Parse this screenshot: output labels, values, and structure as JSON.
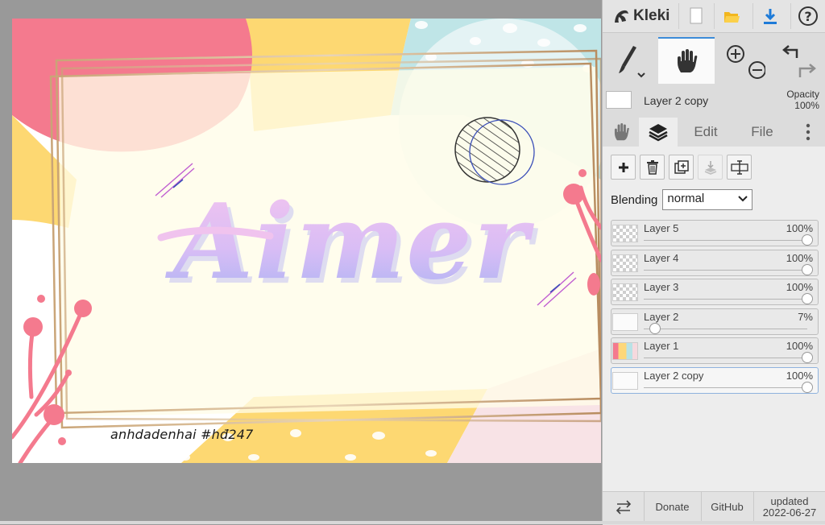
{
  "app": {
    "name": "Kleki"
  },
  "toolbar": {
    "icons": [
      "kleki-logo-icon",
      "new-file-icon",
      "open-folder-icon",
      "download-icon",
      "help-icon"
    ],
    "tools": [
      "brush-icon",
      "hand-icon",
      "zoom-in-icon",
      "zoom-out-icon",
      "undo-icon",
      "redo-icon"
    ],
    "active_tool": "hand"
  },
  "current_layer": {
    "name": "Layer 2 copy",
    "opacity_label": "Opacity",
    "opacity_value": "100%"
  },
  "tabs": [
    {
      "label": "",
      "icon": "hand-icon"
    },
    {
      "label": "",
      "icon": "layers-icon",
      "active": true
    },
    {
      "label": "Edit"
    },
    {
      "label": "File"
    },
    {
      "label": "",
      "icon": "more-vertical-icon"
    }
  ],
  "layer_actions": [
    "add-layer-icon",
    "delete-layer-icon",
    "duplicate-layer-icon",
    "merge-down-icon",
    "rename-layer-icon"
  ],
  "blending": {
    "label": "Blending",
    "value": "normal"
  },
  "layers": [
    {
      "name": "Layer 5",
      "opacity": "100%",
      "level": 1.0,
      "thumb": "checker"
    },
    {
      "name": "Layer 4",
      "opacity": "100%",
      "level": 1.0,
      "thumb": "checker"
    },
    {
      "name": "Layer 3",
      "opacity": "100%",
      "level": 1.0,
      "thumb": "checker"
    },
    {
      "name": "Layer 2",
      "opacity": "7%",
      "level": 0.07,
      "thumb": "white"
    },
    {
      "name": "Layer 1",
      "opacity": "100%",
      "level": 1.0,
      "thumb": "color"
    },
    {
      "name": "Layer 2 copy",
      "opacity": "100%",
      "level": 1.0,
      "thumb": "white",
      "active": true
    }
  ],
  "footer": {
    "donate": "Donate",
    "github": "GitHub",
    "updated_label": "updated",
    "updated_date": "2022-06-27"
  },
  "artwork": {
    "title_text": "Aimer",
    "signature": "anhdadenhai #hđ247"
  },
  "colors": {
    "pink": "#f47a8e",
    "yellow": "#fdd872",
    "mint": "#bfe5e7",
    "accent_blue": "#3c8cd8"
  }
}
